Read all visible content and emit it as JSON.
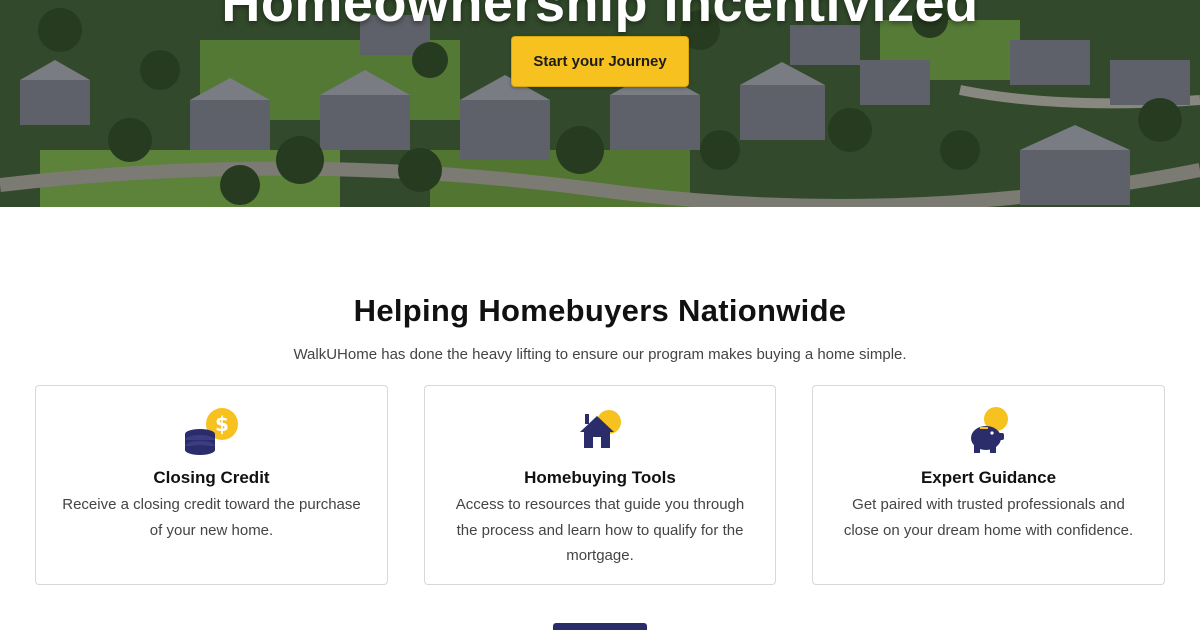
{
  "hero": {
    "title": "Homeownership Incentivized",
    "cta_label": "Start your Journey"
  },
  "section": {
    "title": "Helping Homebuyers Nationwide",
    "subtitle": "WalkUHome has done the heavy lifting to ensure our program makes buying a home simple."
  },
  "cards": [
    {
      "icon": "coins-icon",
      "title": "Closing Credit",
      "text": "Receive a closing credit toward the purchase of your new home."
    },
    {
      "icon": "house-icon",
      "title": "Homebuying Tools",
      "text": "Access to resources that guide you through the process and learn how to qualify for the mortgage."
    },
    {
      "icon": "piggy-bank-icon",
      "title": "Expert Guidance",
      "text": "Get paired with trusted professionals and close on your dream home with confidence."
    }
  ],
  "colors": {
    "accent_yellow": "#f7c21f",
    "brand_navy": "#2b2d6b"
  }
}
